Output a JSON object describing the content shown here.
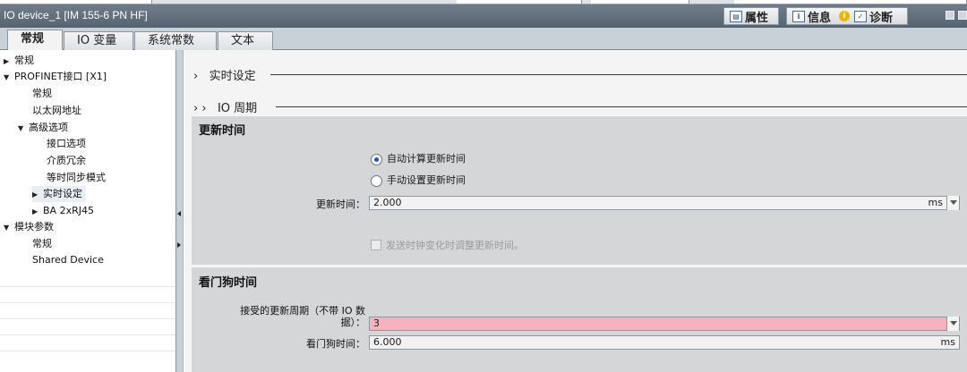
{
  "window": {
    "title": "IO device_1 [IM 155-6 PN HF]"
  },
  "inspector_tabs": [
    {
      "label": "属性",
      "icon": "properties-icon"
    },
    {
      "label": "信息",
      "icon": "info-icon"
    },
    {
      "label": "诊断",
      "icon": "diagnostics-icon"
    }
  ],
  "info_badge": "i",
  "tabs": [
    {
      "label": "常规"
    },
    {
      "label": "IO 变量"
    },
    {
      "label": "系统常数"
    },
    {
      "label": "文本"
    }
  ],
  "nav": [
    {
      "label": "常规",
      "arrow": "▶"
    },
    {
      "label": "PROFINET接口 [X1]",
      "arrow": "▼"
    },
    {
      "label": "常规",
      "arrow": ""
    },
    {
      "label": "以太网地址",
      "arrow": ""
    },
    {
      "label": "高级选项",
      "arrow": "▼"
    },
    {
      "label": "接口选项",
      "arrow": ""
    },
    {
      "label": "介质冗余",
      "arrow": ""
    },
    {
      "label": "等时同步模式",
      "arrow": ""
    },
    {
      "label": "实时设定",
      "arrow": "▶"
    },
    {
      "label": "BA 2xRJ45",
      "arrow": "▶"
    },
    {
      "label": "模块参数",
      "arrow": "▼"
    },
    {
      "label": "常规",
      "arrow": ""
    },
    {
      "label": "Shared Device",
      "arrow": ""
    }
  ],
  "sections": {
    "realtime": "实时设定",
    "realtime_prefix": "›",
    "io_cycle": "IO 周期",
    "io_cycle_prefix": "› ›"
  },
  "update_time": {
    "title": "更新时间",
    "radio_auto": "自动计算更新时间",
    "radio_manual": "手动设置更新时间",
    "selected": "auto",
    "field_label": "更新时间：",
    "value": "2.000",
    "unit": "ms",
    "checkbox_label": "发送时钟变化时调整更新时间。"
  },
  "watchdog": {
    "title": "看门狗时间",
    "accepted_label_line1": "接受的更新周期（不带 IO 数",
    "accepted_label_line2": "据）：",
    "accepted_value": "3",
    "watchdog_label": "看门狗时间：",
    "watchdog_value": "6.000",
    "watchdog_unit": "ms"
  }
}
